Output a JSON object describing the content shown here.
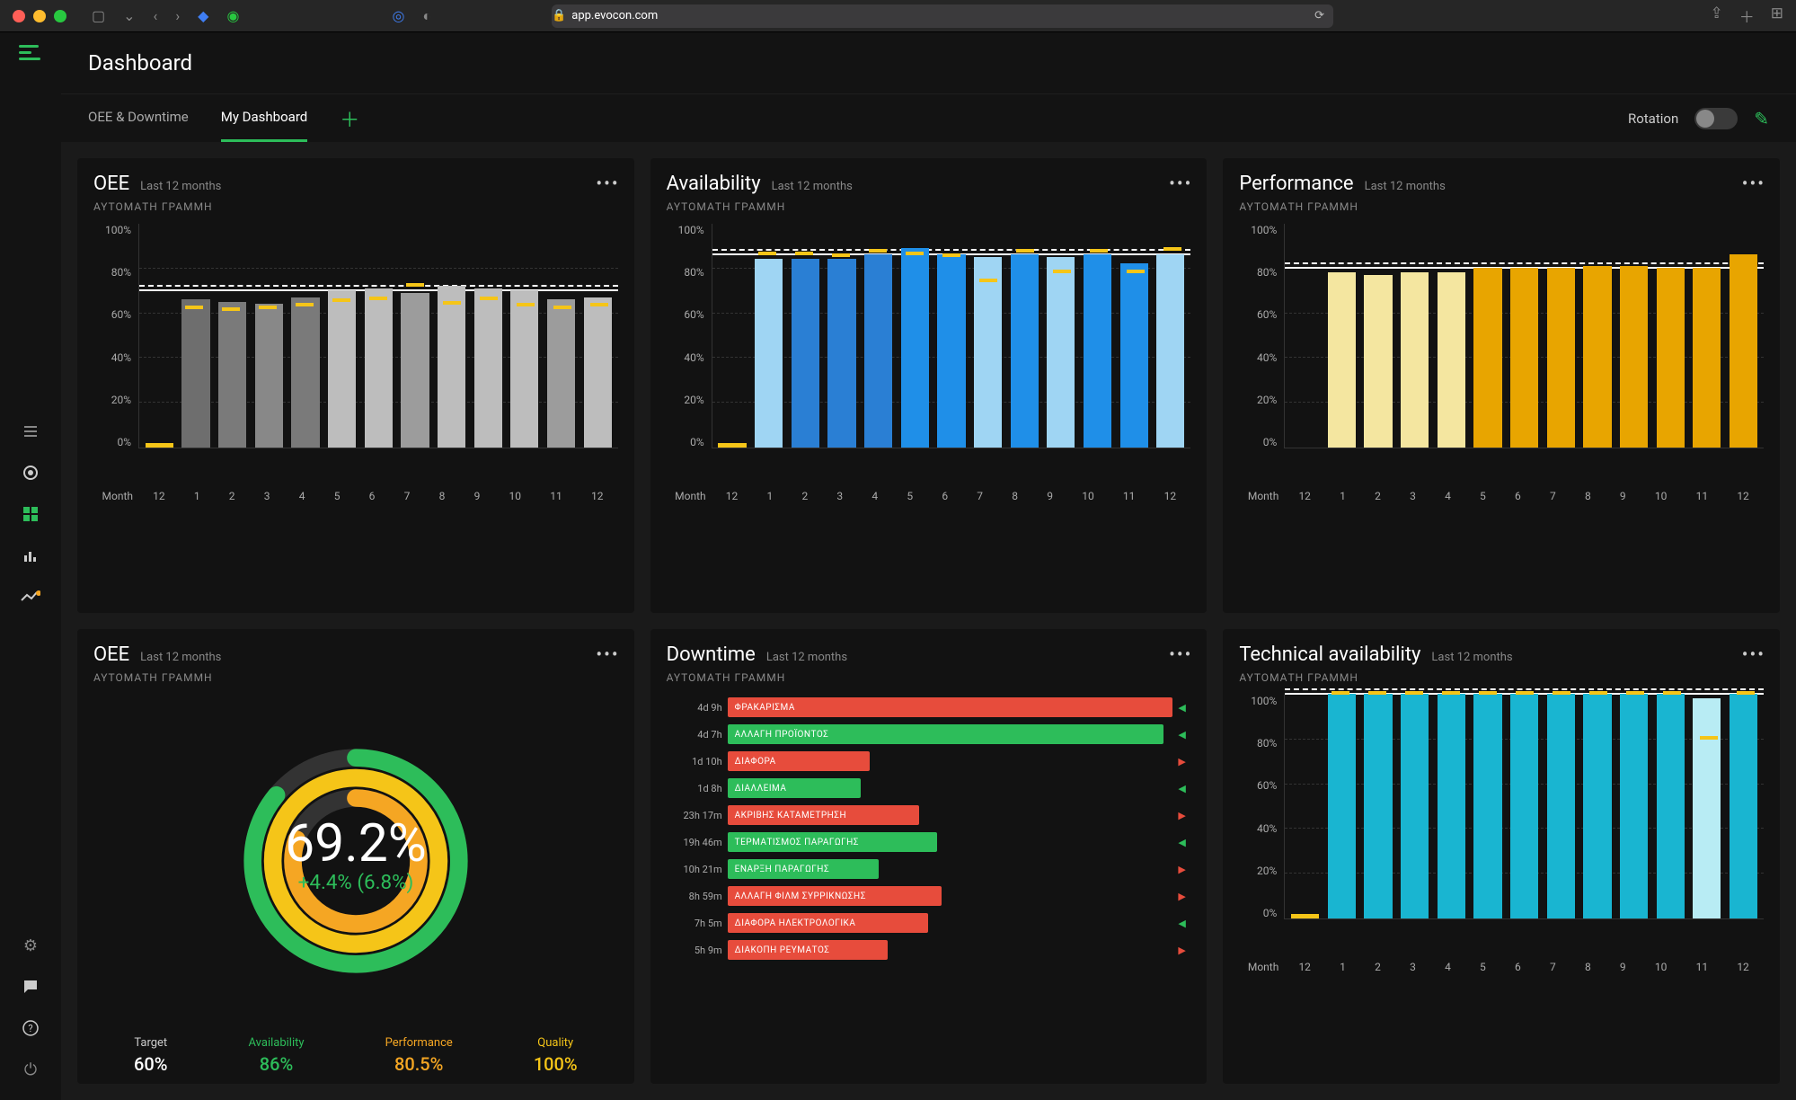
{
  "browser": {
    "url_display": "app.evocon.com",
    "colors": {
      "green": "#2dbd5a"
    }
  },
  "header": {
    "title": "Dashboard"
  },
  "tabs": {
    "items": [
      "OEE & Downtime",
      "My Dashboard"
    ],
    "active_index": 1
  },
  "rotation_label": "Rotation",
  "common": {
    "sub_last_12": "Last 12 months",
    "line_label": "ΑΥΤΟΜΑΤΗ ΓΡΑΜΜΗ",
    "month_label": "Month",
    "yaxis_ticks": [
      "100%",
      "80%",
      "60%",
      "40%",
      "20%",
      "0%"
    ],
    "months": [
      "12",
      "1",
      "2",
      "3",
      "4",
      "5",
      "6",
      "7",
      "8",
      "9",
      "10",
      "11",
      "12"
    ]
  },
  "cards": {
    "oee_bars": {
      "title": "OEE"
    },
    "availability": {
      "title": "Availability"
    },
    "performance": {
      "title": "Performance"
    },
    "oee_circle": {
      "title": "OEE",
      "value": "69.2%",
      "delta": "+4.4% (6.8%)",
      "kpis": {
        "target": {
          "label": "Target",
          "value": "60%"
        },
        "availability": {
          "label": "Availability",
          "value": "86%"
        },
        "performance": {
          "label": "Performance",
          "value": "80.5%"
        },
        "quality": {
          "label": "Quality",
          "value": "100%"
        }
      }
    },
    "downtime": {
      "title": "Downtime"
    },
    "technical": {
      "title": "Technical availability"
    }
  },
  "chart_data": [
    {
      "id": "oee_bars",
      "type": "bar",
      "categories": [
        "12",
        "1",
        "2",
        "3",
        "4",
        "5",
        "6",
        "7",
        "8",
        "9",
        "10",
        "11",
        "12"
      ],
      "series": [
        {
          "name": "OEE",
          "values": [
            2,
            66,
            65,
            64,
            67,
            70,
            71,
            69,
            72,
            71,
            70,
            66,
            67
          ],
          "colors": [
            "#f5c518",
            "#6e6e6e",
            "#7a7a7a",
            "#888",
            "#7a7a7a",
            "#bdbdbd",
            "#bdbdbd",
            "#9c9c9c",
            "#bdbdbd",
            "#bdbdbd",
            "#bdbdbd",
            "#9c9c9c",
            "#bdbdbd"
          ]
        },
        {
          "name": "marker",
          "values": [
            null,
            62,
            61,
            62,
            63,
            65,
            66,
            72,
            64,
            66,
            63,
            62,
            63
          ]
        }
      ],
      "target_line": 70,
      "ylim": [
        0,
        100
      ],
      "ylabel": "",
      "xlabel": "Month"
    },
    {
      "id": "availability",
      "type": "bar",
      "categories": [
        "12",
        "1",
        "2",
        "3",
        "4",
        "5",
        "6",
        "7",
        "8",
        "9",
        "10",
        "11",
        "12"
      ],
      "series": [
        {
          "name": "Availability",
          "values": [
            2,
            84,
            84,
            84,
            86,
            89,
            86,
            85,
            86,
            85,
            86,
            82,
            86
          ],
          "colors": [
            "#f5c518",
            "#9fd5f3",
            "#2a7fd4",
            "#2a7fd4",
            "#2a7fd4",
            "#1f8fe8",
            "#1f8fe8",
            "#9fd5f3",
            "#1f8fe8",
            "#9fd5f3",
            "#1f8fe8",
            "#1f8fe8",
            "#9fd5f3"
          ]
        },
        {
          "name": "marker",
          "values": [
            null,
            86,
            86,
            85,
            87,
            86,
            85,
            74,
            87,
            78,
            87,
            78,
            88
          ]
        }
      ],
      "target_line": 86,
      "ylim": [
        0,
        100
      ],
      "ylabel": "",
      "xlabel": "Month"
    },
    {
      "id": "performance",
      "type": "bar",
      "categories": [
        "12",
        "1",
        "2",
        "3",
        "4",
        "5",
        "6",
        "7",
        "8",
        "9",
        "10",
        "11",
        "12"
      ],
      "series": [
        {
          "name": "Performance",
          "values": [
            null,
            78,
            77,
            78,
            78,
            80,
            80,
            80,
            81,
            81,
            80,
            80,
            86
          ],
          "colors": [
            null,
            "#f4e6a0",
            "#f4e6a0",
            "#f4e6a0",
            "#f4e6a0",
            "#e8a500",
            "#e8a500",
            "#e8a500",
            "#e8a500",
            "#e8a500",
            "#e8a500",
            "#e8a500",
            "#e8a500"
          ]
        }
      ],
      "target_line": 80,
      "ylim": [
        0,
        100
      ],
      "ylabel": "",
      "xlabel": "Month"
    },
    {
      "id": "technical",
      "type": "bar",
      "categories": [
        "12",
        "1",
        "2",
        "3",
        "4",
        "5",
        "6",
        "7",
        "8",
        "9",
        "10",
        "11",
        "12"
      ],
      "series": [
        {
          "name": "Technical availability",
          "values": [
            2,
            100,
            100,
            100,
            100,
            100,
            100,
            100,
            100,
            100,
            100,
            98,
            100
          ],
          "colors": [
            "#f5c518",
            "#19b5d1",
            "#19b5d1",
            "#19b5d1",
            "#19b5d1",
            "#19b5d1",
            "#19b5d1",
            "#19b5d1",
            "#19b5d1",
            "#19b5d1",
            "#19b5d1",
            "#b8ecf4",
            "#19b5d1"
          ]
        },
        {
          "name": "marker",
          "values": [
            null,
            100,
            100,
            100,
            100,
            100,
            100,
            100,
            100,
            100,
            100,
            80,
            100
          ]
        }
      ],
      "target_line": 100,
      "ylim": [
        0,
        100
      ],
      "ylabel": "",
      "xlabel": "Month"
    },
    {
      "id": "downtime",
      "type": "bar_horizontal",
      "items": [
        {
          "time": "4d 9h",
          "label": "ΦΡΑΚΑΡΙΣΜΑ",
          "pct": 100,
          "color": "#e74c3c",
          "arrow": "up"
        },
        {
          "time": "4d 7h",
          "label": "ΑΛΛΑΓΗ ΠΡΟΪΟΝΤΟΣ",
          "pct": 98,
          "color": "#2dbd5a",
          "arrow": "up"
        },
        {
          "time": "1d 10h",
          "label": "ΔΙΑΦΟΡΑ",
          "pct": 32,
          "color": "#e74c3c",
          "arrow": "down"
        },
        {
          "time": "1d 8h",
          "label": "ΔΙΑΛΛΕΙΜΑ",
          "pct": 30,
          "color": "#2dbd5a",
          "arrow": "up"
        },
        {
          "time": "23h 17m",
          "label": "ΑΚΡΙΒΗΣ ΚΑΤΑΜΕΤΡΗΣΗ",
          "pct": 43,
          "color": "#e74c3c",
          "arrow": "down"
        },
        {
          "time": "19h 46m",
          "label": "ΤΕΡΜΑΤΙΣΜΟΣ ΠΑΡΑΓΩΓΗΣ",
          "pct": 47,
          "color": "#2dbd5a",
          "arrow": "up"
        },
        {
          "time": "10h 21m",
          "label": "ΕΝΑΡΞΗ ΠΑΡΑΓΩΓΗΣ",
          "pct": 34,
          "color": "#2dbd5a",
          "arrow": "down"
        },
        {
          "time": "8h 59m",
          "label": "ΑΛΛΑΓΗ ΦΙΛΜ ΣΥΡΡΙΚΝΩΣΗΣ",
          "pct": 48,
          "color": "#e74c3c",
          "arrow": "down"
        },
        {
          "time": "7h 5m",
          "label": "ΔΙΑΦΟΡΑ ΗΛΕΚΤΡΟΛΟΓΙΚΑ",
          "pct": 45,
          "color": "#e74c3c",
          "arrow": "up"
        },
        {
          "time": "5h 9m",
          "label": "ΔΙΑΚΟΠΗ ΡΕΥΜΑΤΟΣ",
          "pct": 36,
          "color": "#e74c3c",
          "arrow": "down"
        }
      ]
    }
  ]
}
